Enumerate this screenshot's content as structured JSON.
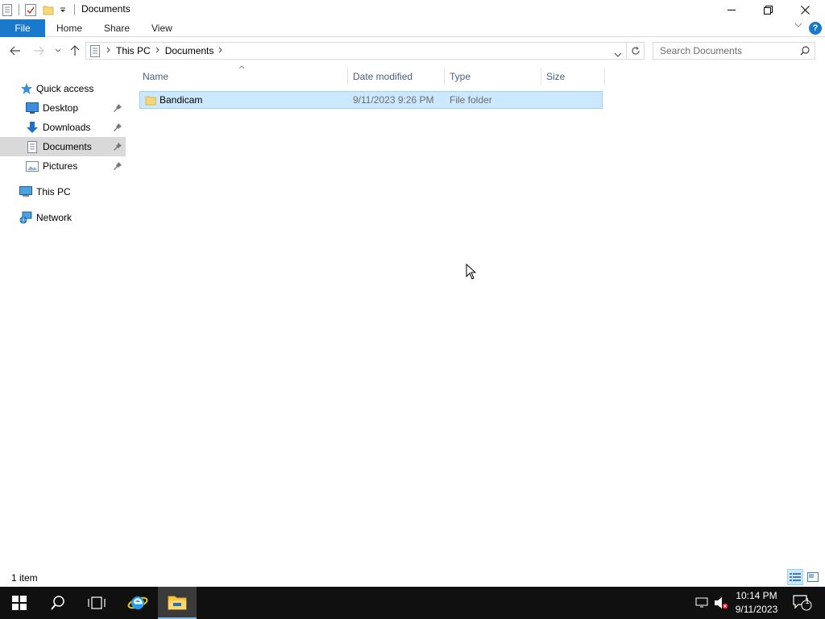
{
  "window": {
    "title": "Documents"
  },
  "ribbon": {
    "file_label": "File",
    "tabs": [
      "Home",
      "Share",
      "View"
    ]
  },
  "address_bar": {
    "crumbs": [
      "This PC",
      "Documents"
    ]
  },
  "search": {
    "placeholder": "Search Documents"
  },
  "nav_pane": {
    "items": [
      {
        "label": "Quick access",
        "icon": "star-icon"
      },
      {
        "label": "Desktop",
        "icon": "desktop-icon",
        "pinned": true
      },
      {
        "label": "Downloads",
        "icon": "downloads-icon",
        "pinned": true
      },
      {
        "label": "Documents",
        "icon": "documents-icon",
        "pinned": true,
        "selected": true
      },
      {
        "label": "Pictures",
        "icon": "pictures-icon",
        "pinned": true
      },
      {
        "label": "This PC",
        "icon": "computer-icon"
      },
      {
        "label": "Network",
        "icon": "network-icon"
      }
    ]
  },
  "file_list": {
    "columns": [
      "Name",
      "Date modified",
      "Type",
      "Size"
    ],
    "rows": [
      {
        "name": "Bandicam",
        "date_modified": "9/11/2023 9:26 PM",
        "type": "File folder",
        "size": "",
        "selected": true
      }
    ]
  },
  "status_bar": {
    "item_count": "1 item"
  },
  "taskbar": {
    "time": "10:14 PM",
    "date": "9/11/2023",
    "notification_count": "1"
  },
  "colors": {
    "accent": "#1979ca",
    "selection_bg": "#cce8ff",
    "selection_border": "#99d1ff",
    "taskbar_bg": "#101010"
  }
}
